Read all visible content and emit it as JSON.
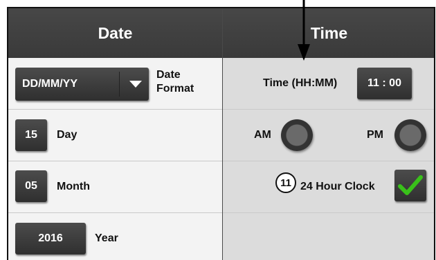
{
  "date_panel": {
    "title": "Date",
    "format_value": "DD/MM/YY",
    "format_label_line1": "Date",
    "format_label_line2": "Format",
    "day_value": "15",
    "day_label": "Day",
    "month_value": "05",
    "month_label": "Month",
    "year_value": "2016",
    "year_label": "Year"
  },
  "time_panel": {
    "title": "Time",
    "time_label": "Time (HH:MM)",
    "time_value": "11 : 00",
    "am_label": "AM",
    "pm_label": "PM",
    "clock_label": "24 Hour Clock",
    "clock_checked": true
  },
  "callout": {
    "number": "11"
  },
  "colors": {
    "header": "#3f3f3f",
    "check": "#39c11a"
  }
}
